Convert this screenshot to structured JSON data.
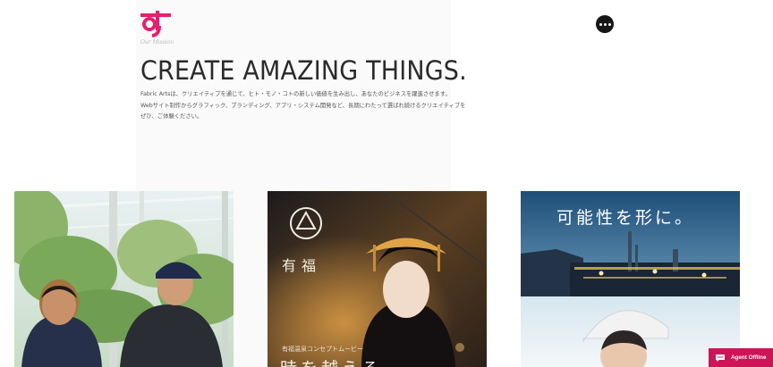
{
  "header": {
    "logo": {
      "tagline": "Our Mission"
    },
    "menu_icon": "more-horizontal-icon"
  },
  "hero": {
    "headline": "CREATE AMAZING THINGS.",
    "body": [
      "Fabric Artsは、クリエイティブを通じて、ヒト・モノ・コトの新しい価値を生み出し、あなたのビジネスを躍進させます。",
      "Webサイト制作からグラフィック、ブランディング、アプリ・システム開発など、長期にわたって選ばれ続けるクリエイティブを",
      "ぜひ、ご体験ください。"
    ]
  },
  "cards": [
    {
      "id": "farm-photo"
    },
    {
      "id": "arita-onsen",
      "logo_name": "有福",
      "subtitle": "有福温泉コンセプトムービー",
      "title": "時を越える"
    },
    {
      "id": "industry",
      "headline": "可能性を形に。"
    }
  ],
  "chat": {
    "label": "Agent Offline",
    "icon": "chat-bubble-icon"
  },
  "colors": {
    "brand": "#e6206f",
    "chat": "#cc1456"
  }
}
